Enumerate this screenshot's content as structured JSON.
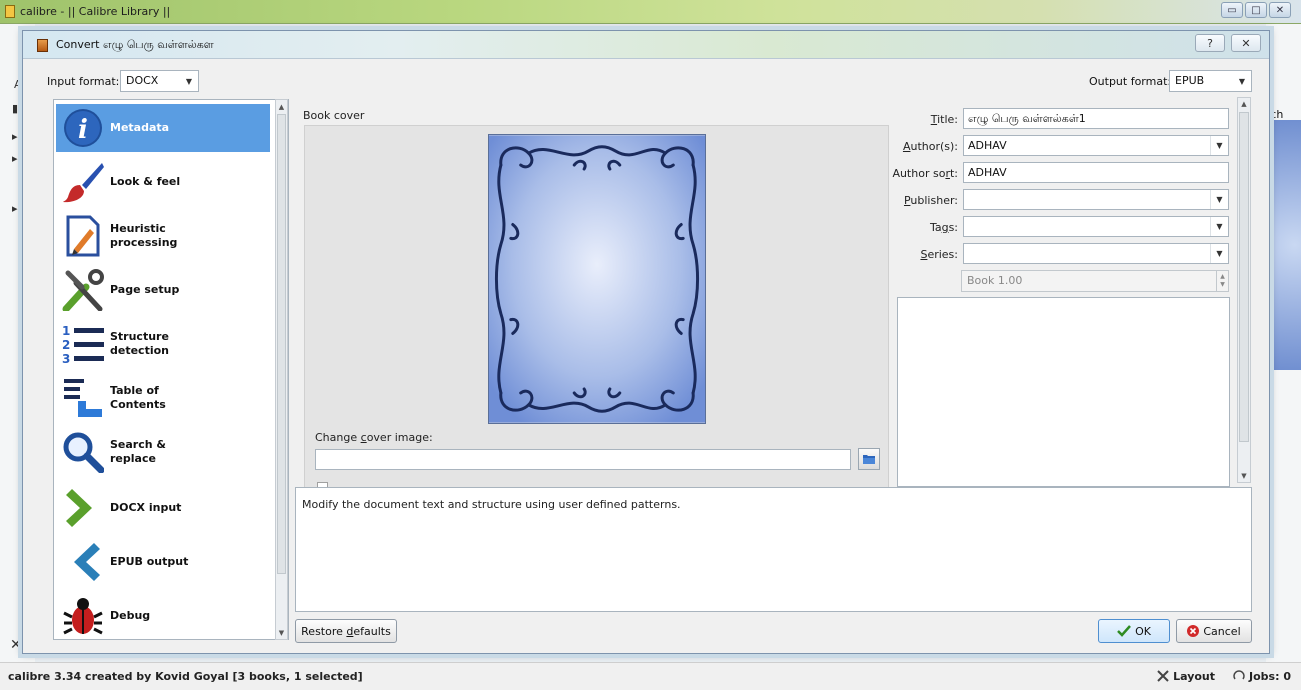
{
  "main_window": {
    "title": "calibre - || Calibre Library ||",
    "controls": [
      "minimize-icon",
      "maximize-icon",
      "close-icon"
    ],
    "left_fragments": [
      "Ad",
      "rch"
    ],
    "status_left": "calibre 3.34 created by Kovid Goyal   [3 books, 1 selected]",
    "status_layout": "Layout",
    "status_jobs": "Jobs: 0"
  },
  "dialog": {
    "title": "Convert எழு பெரு வள்ளல்கள",
    "help_icon": "?",
    "input_format_label": "Input format:",
    "input_format_value": "DOCX",
    "output_format_label": "Output format:",
    "output_format_value": "EPUB"
  },
  "sidebar": {
    "items": [
      {
        "label": "Metadata",
        "icon": "info-icon"
      },
      {
        "label": "Look & feel",
        "icon": "paintbrush-icon"
      },
      {
        "label": "Heuristic\nprocessing",
        "icon": "heuristic-icon"
      },
      {
        "label": "Page setup",
        "icon": "tools-icon"
      },
      {
        "label": "Structure\ndetection",
        "icon": "list-numbered-icon"
      },
      {
        "label": "Table of\nContents",
        "icon": "toc-icon"
      },
      {
        "label": "Search &\nreplace",
        "icon": "magnifier-icon"
      },
      {
        "label": "DOCX input",
        "icon": "chevron-right-icon"
      },
      {
        "label": "EPUB output",
        "icon": "chevron-left-icon"
      },
      {
        "label": "Debug",
        "icon": "bug-icon"
      }
    ],
    "selected_index": 0
  },
  "metadata": {
    "book_cover_label": "Book cover",
    "change_cover_label": "Change cover image:",
    "change_cover_value": "",
    "fields": {
      "title_label": "Title:",
      "title_value": "எழு பெரு வள்ளல்கள்1",
      "authors_label": "Author(s):",
      "authors_value": "ADHAV",
      "author_sort_label": "Author sort:",
      "author_sort_value": "ADHAV",
      "publisher_label": "Publisher:",
      "publisher_value": "",
      "tags_label": "Tags:",
      "tags_value": "",
      "series_label": "Series:",
      "series_value": "",
      "series_index": "Book 1.00"
    }
  },
  "help_text": "Modify the document text and structure using user defined patterns.",
  "buttons": {
    "restore_defaults": "Restore defaults",
    "ok": "OK",
    "cancel": "Cancel"
  }
}
